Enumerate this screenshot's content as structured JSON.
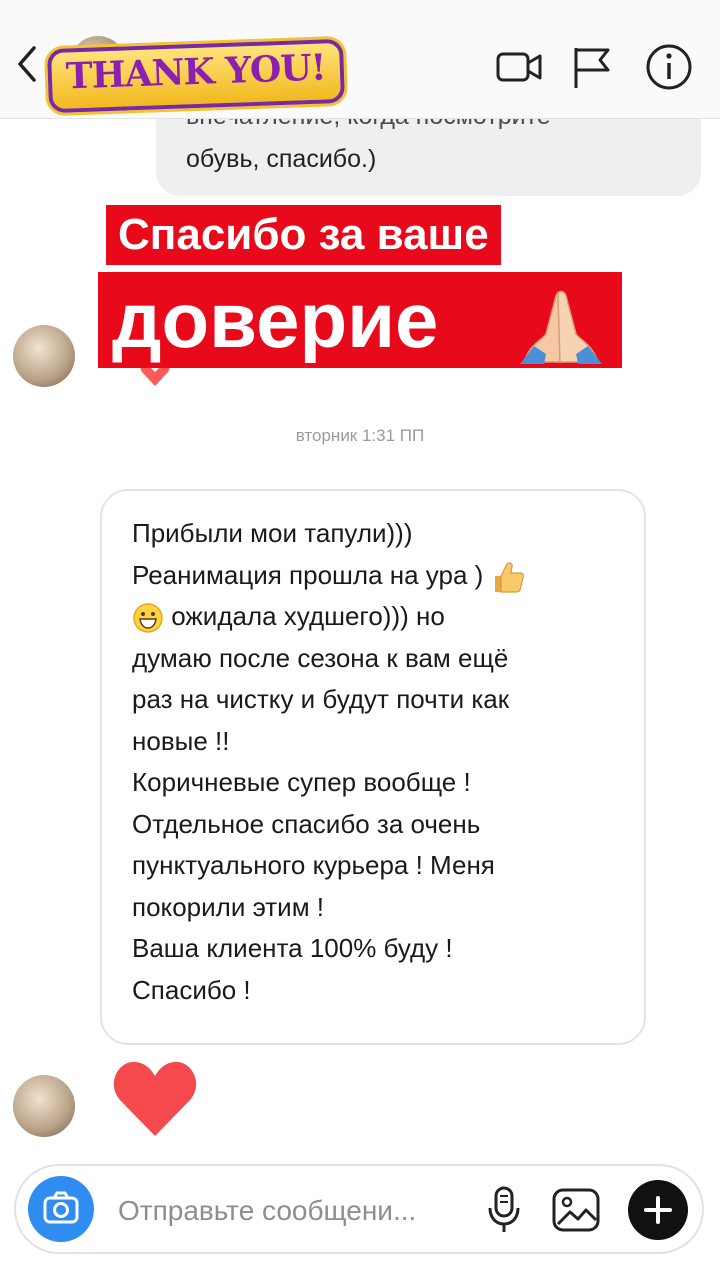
{
  "header": {
    "sticker_text": "THANK YOU!",
    "icons": [
      "back-chevron-icon",
      "video-call-icon",
      "flag-icon",
      "info-icon"
    ]
  },
  "thread": {
    "previous_message": {
      "partial_line": "впечатление, когда посмотрите",
      "last_line": "обувь, спасибо.)"
    },
    "banner": {
      "line1": "Спасибо за ваше",
      "line2": "доверие",
      "emoji": "folded-hands-icon",
      "color": "#e8091a"
    },
    "timestamp": "вторник 1:31 ПП",
    "message_lines": [
      "Прибыли мои тапули)))",
      "Реанимация прошла на ура )",
      "ожидала худшего))) но",
      "думаю после сезона к вам ещё",
      "раз на чистку и будут почти как",
      "новые !!",
      "Коричневые супер вообще !",
      "Отдельное спасибо за очень",
      "пунктуального курьера ! Меня",
      "покорили этим !",
      "Ваша клиента 100% буду !",
      "Спасибо !"
    ],
    "reaction": "heart-icon"
  },
  "composer": {
    "placeholder": "Отправьте сообщени...",
    "accent": "#2f8cf0"
  }
}
